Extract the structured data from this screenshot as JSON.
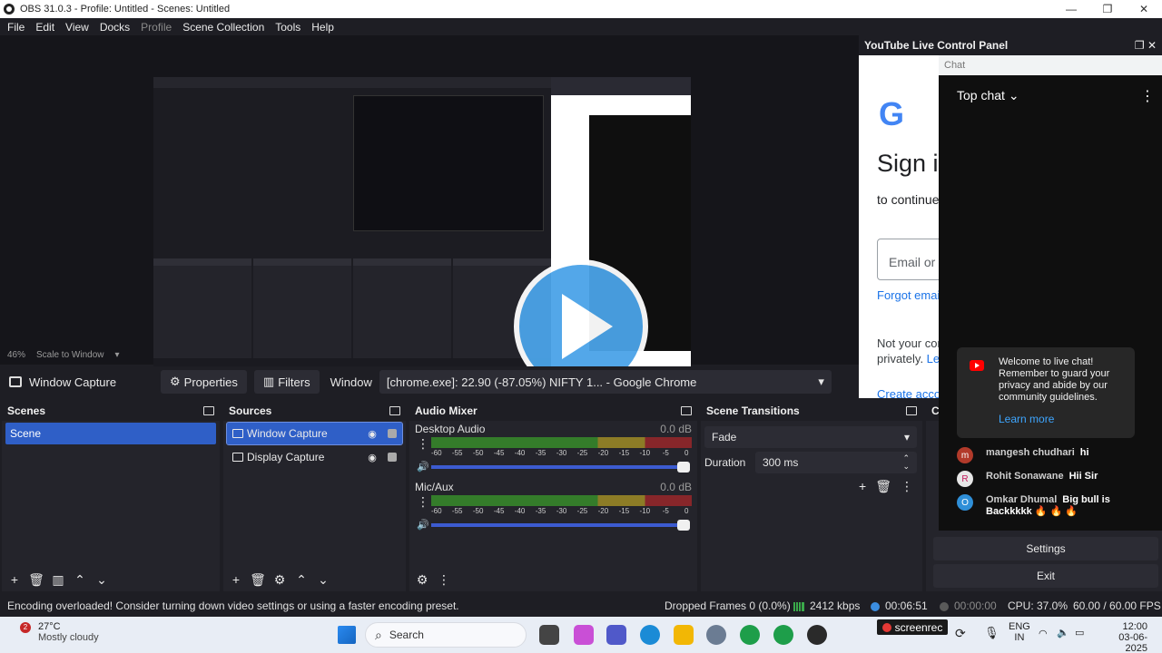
{
  "window": {
    "title": "OBS 31.0.3 - Profile: Untitled - Scenes: Untitled",
    "minimize": "—",
    "maximize": "❐",
    "close": "✕"
  },
  "menu": [
    "File",
    "Edit",
    "View",
    "Docks",
    "Profile",
    "Scene Collection",
    "Tools",
    "Help"
  ],
  "preview": {
    "zoom": "46%",
    "scale_mode": "Scale to Window"
  },
  "source_toolbar": {
    "source_name": "Window Capture",
    "properties": "Properties",
    "filters": "Filters",
    "window_label": "Window",
    "window_value": "[chrome.exe]: 22.90 (-87.05%) NIFTY 1... - Google Chrome"
  },
  "scenes": {
    "title": "Scenes",
    "items": [
      "Scene"
    ]
  },
  "sources": {
    "title": "Sources",
    "items": [
      "Window Capture",
      "Display Capture"
    ]
  },
  "audio_mixer": {
    "title": "Audio Mixer",
    "channels": [
      {
        "name": "Desktop Audio",
        "db": "0.0 dB"
      },
      {
        "name": "Mic/Aux",
        "db": "0.0 dB"
      }
    ],
    "ticks": [
      "-60",
      "-55",
      "-50",
      "-45",
      "-40",
      "-35",
      "-30",
      "-25",
      "-20",
      "-15",
      "-10",
      "-5",
      "0"
    ]
  },
  "transitions": {
    "title": "Scene Transitions",
    "selected": "Fade",
    "duration_label": "Duration",
    "duration_value": "300 ms"
  },
  "controls": {
    "title": "C",
    "settings": "Settings",
    "exit": "Exit"
  },
  "youtube": {
    "title": "YouTube Live Control Panel",
    "chat_tab": "Chat",
    "signin_title": "Sign i",
    "signin_sub": "to continue",
    "input_placeholder": "Email or",
    "forgot": "Forgot emai",
    "note1": "Not your com",
    "note2_text": "privately. ",
    "note2_link": "Lea",
    "create": "Create acco",
    "chat_header": "Top chat",
    "welcome": "Welcome to live chat! Remember to guard your privacy and abide by our community guidelines.",
    "learn_more": "Learn more",
    "messages": [
      {
        "initial": "m",
        "name": "mangesh chudhari",
        "text": "hi",
        "color": "#b23a2a"
      },
      {
        "initial": "R",
        "name": "Rohit Sonawane",
        "text": "Hii Sir",
        "color": "#e7e7e7"
      },
      {
        "initial": "O",
        "name": "Omkar Dhumal",
        "text": "Big bull is Backkkkk 🔥 🔥 🔥",
        "color": "#2f8fd8"
      }
    ]
  },
  "status": {
    "message": "Encoding overloaded! Consider turning down video settings or using a faster encoding preset.",
    "dropped": "Dropped Frames 0 (0.0%)",
    "bitrate": "2412 kbps",
    "stream_time": "00:06:51",
    "rec_time": "00:00:00",
    "cpu": "CPU: 37.0%",
    "fps": "60.00 / 60.00 FPS"
  },
  "taskbar": {
    "weather_badge": "2",
    "temperature": "27°C",
    "weather": "Mostly cloudy",
    "search": "Search",
    "screenrec": "screenrec",
    "lang1": "ENG",
    "lang2": "IN",
    "time": "12:00",
    "date": "03-06-2025"
  }
}
